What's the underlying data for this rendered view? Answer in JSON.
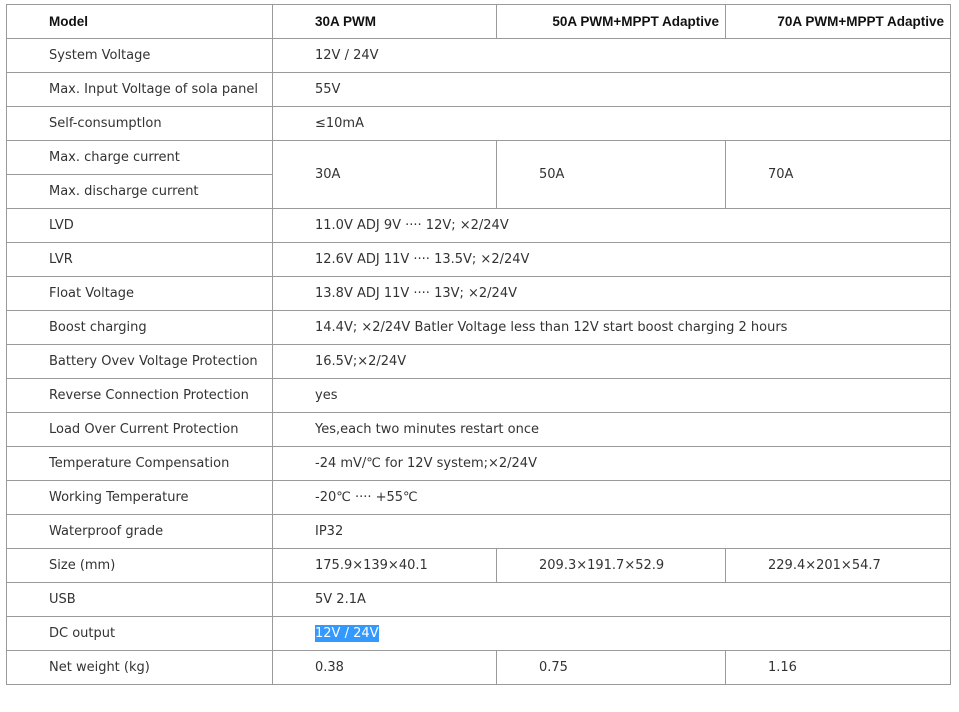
{
  "header": {
    "model": "Model",
    "col1": "30A PWM",
    "col2": "50A PWM+MPPT Adaptive",
    "col3": "70A  PWM+MPPT Adaptive"
  },
  "rows": {
    "system_voltage": {
      "label": "System Voltage",
      "value": "12V / 24V"
    },
    "max_input_voltage": {
      "label": "Max. Input Voltage of sola panel",
      "value": "55V"
    },
    "self_consumption": {
      "label": "Self-consumptlon",
      "value": "≤10mA"
    },
    "max_charge_current": {
      "label": "Max. charge current"
    },
    "max_discharge_current": {
      "label": "Max. discharge current"
    },
    "current_values": {
      "c1": "30A",
      "c2": "50A",
      "c3": "70A"
    },
    "lvd": {
      "label": "LVD",
      "value": "11.0V ADJ 9V ···· 12V; ×2/24V"
    },
    "lvr": {
      "label": "LVR",
      "value": "12.6V ADJ 11V ···· 13.5V; ×2/24V"
    },
    "float_voltage": {
      "label": "Float Voltage",
      "value": "13.8V ADJ 11V ···· 13V; ×2/24V"
    },
    "boost_charging": {
      "label": "Boost charging",
      "value": "14.4V; ×2/24V Batler Voltage less than 12V start boost charging 2 hours"
    },
    "battery_over_voltage": {
      "label": "Battery Ovev Voltage Protection",
      "value": "16.5V;×2/24V"
    },
    "reverse_connection": {
      "label": "Reverse Connection Protection",
      "value": "yes"
    },
    "load_over_current": {
      "label": "Load Over Current Protection",
      "value": "Yes,each two minutes restart once"
    },
    "temperature_compensation": {
      "label": "Temperature Compensation",
      "value": "-24 mV/℃ for 12V system;×2/24V"
    },
    "working_temperature": {
      "label": "Working Temperature",
      "value": "-20℃ ···· +55℃"
    },
    "waterproof_grade": {
      "label": "Waterproof grade",
      "value": "IP32"
    },
    "size": {
      "label": "Size (mm)",
      "c1": "175.9×139×40.1",
      "c2": "209.3×191.7×52.9",
      "c3": "229.4×201×54.7"
    },
    "usb": {
      "label": "USB",
      "value": "5V 2.1A"
    },
    "dc_output": {
      "label": "DC output",
      "value": "12V / 24V"
    },
    "net_weight": {
      "label": "Net weight (kg)",
      "c1": "0.38",
      "c2": "0.75",
      "c3": "1.16"
    }
  },
  "colors": {
    "border": "#9a9a9a",
    "text": "#333333",
    "selection": "#3399ff"
  }
}
